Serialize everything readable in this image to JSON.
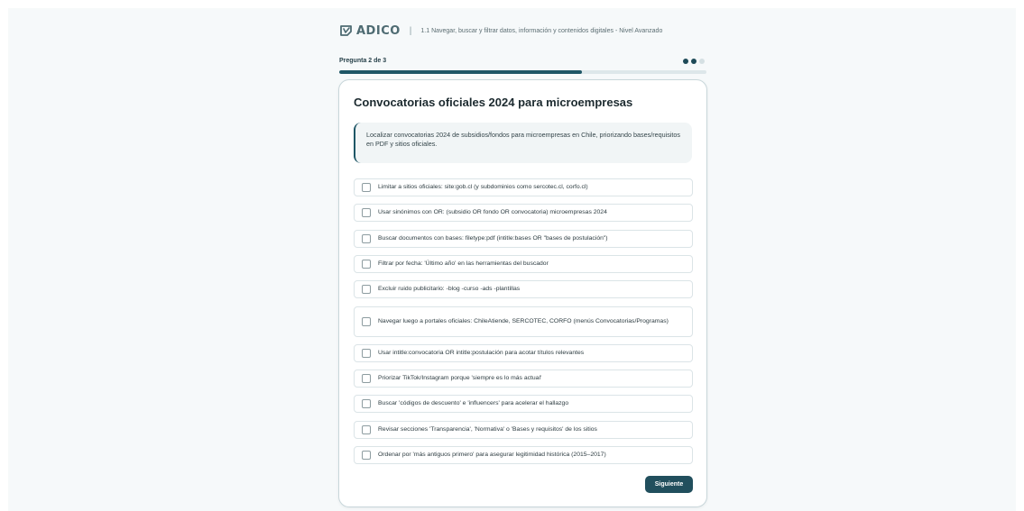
{
  "header": {
    "logo_text": "ADICO",
    "separator": "|",
    "subtitle": "1.1 Navegar, buscar y filtrar datos, información y contenidos digitales - Nivel Avanzado"
  },
  "progress": {
    "label": "Pregunta 2 de 3",
    "current": 2,
    "total": 3,
    "fill_fraction": 0.66
  },
  "card": {
    "title": "Convocatorias oficiales 2024 para microempresas",
    "description": "Localizar convocatorias 2024 de subsidios/fondos para microempresas en Chile, priorizando bases/requisitos en PDF y sitios oficiales."
  },
  "options": [
    {
      "label": "Limitar a sitios oficiales: site:gob.cl (y subdominios como sercotec.cl, corfo.cl)",
      "checked": false
    },
    {
      "label": "Usar sinónimos con OR: (subsidio OR fondo OR convocatoria) microempresas 2024",
      "checked": false
    },
    {
      "label": "Buscar documentos con bases: filetype:pdf (intitle:bases OR \"bases de postulación\")",
      "checked": false
    },
    {
      "label": "Filtrar por fecha: 'Último año' en las herramientas del buscador",
      "checked": false
    },
    {
      "label": "Excluir ruido publicitario: -blog -curso -ads -plantillas",
      "checked": false
    },
    {
      "label": "Navegar luego a portales oficiales: ChileAtiende, SERCOTEC, CORFO (menús Convocatorias/Programas)",
      "checked": false
    },
    {
      "label": "Usar intitle:convocatoria OR intitle:postulación para acotar títulos relevantes",
      "checked": false
    },
    {
      "label": "Priorizar TikTok/Instagram porque 'siempre es lo más actual'",
      "checked": false
    },
    {
      "label": "Buscar 'códigos de descuento' e 'influencers' para acelerar el hallazgo",
      "checked": false
    },
    {
      "label": "Revisar secciones 'Transparencia', 'Normativa' o 'Bases y requisitos' de los sitios",
      "checked": false
    },
    {
      "label": "Ordenar por 'más antiguos primero' para asegurar legitimidad histórica (2015–2017)",
      "checked": false
    }
  ],
  "next_button": {
    "label": "Siguiente"
  },
  "colors": {
    "accent": "#214f5d",
    "progress_fill": "#1e5666",
    "background": "#f6f9fa",
    "card_border": "#c8d6da"
  }
}
